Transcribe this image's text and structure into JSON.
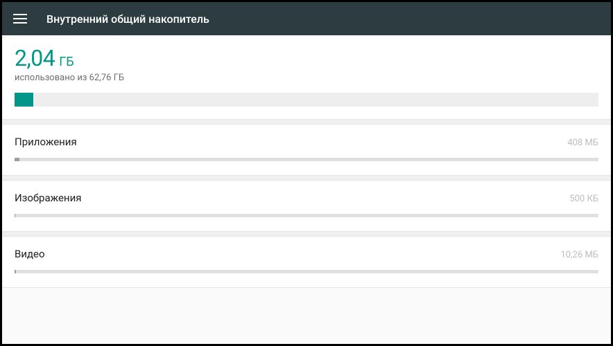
{
  "header": {
    "title": "Внутренний общий накопитель"
  },
  "storage": {
    "used_value": "2,04",
    "used_unit": "ГБ",
    "used_subtext": "использовано из 62,76 ГБ",
    "total_bar_fill_percent": 3.25
  },
  "categories": [
    {
      "label": "Приложения",
      "size": "408 МБ",
      "bar_fill_percent": 0.8
    },
    {
      "label": "Изображения",
      "size": "500 КБ",
      "bar_fill_percent": 0.1
    },
    {
      "label": "Видео",
      "size": "10,26 МБ",
      "bar_fill_percent": 0.2
    }
  ],
  "colors": {
    "accent": "#009688",
    "appbar": "#2d3c41"
  }
}
